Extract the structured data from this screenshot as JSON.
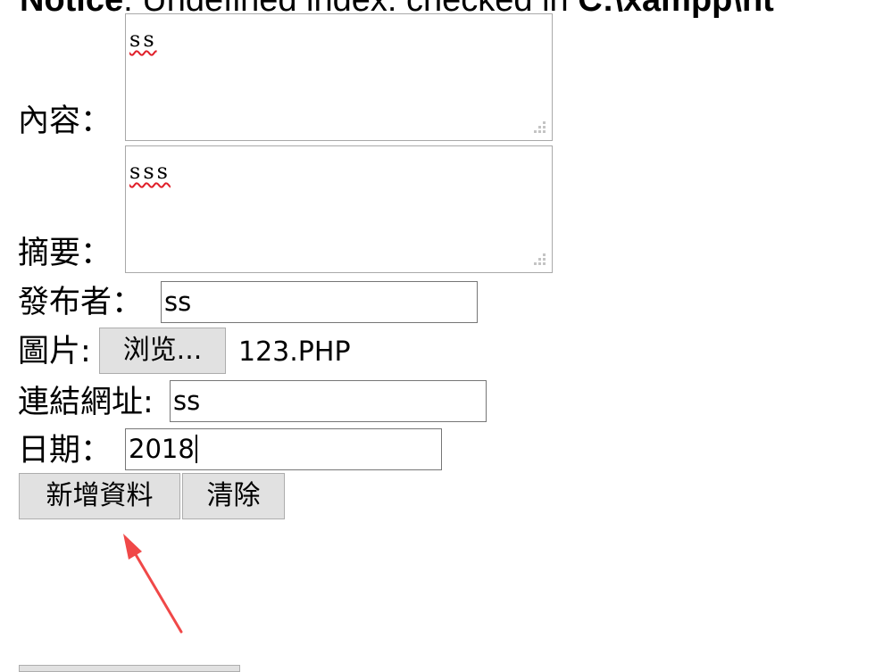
{
  "notice": {
    "prefix": "Notice",
    "message": ": Undefined index: checked in ",
    "path": "C:\\xampp\\ht"
  },
  "form": {
    "content": {
      "label": "內容：",
      "value": "ss"
    },
    "summary": {
      "label": "摘要：",
      "value": "sss"
    },
    "publisher": {
      "label": "發布者：",
      "value": "ss"
    },
    "image": {
      "label": "圖片:",
      "browse_button": "浏览...",
      "filename": "123.PHP"
    },
    "link": {
      "label": "連結網址:",
      "value": "ss"
    },
    "date": {
      "label": "日期：",
      "value": "2018"
    },
    "submit_button": "新增資料",
    "reset_button": "清除"
  },
  "annotation": {
    "arrow_color": "#f04848"
  }
}
